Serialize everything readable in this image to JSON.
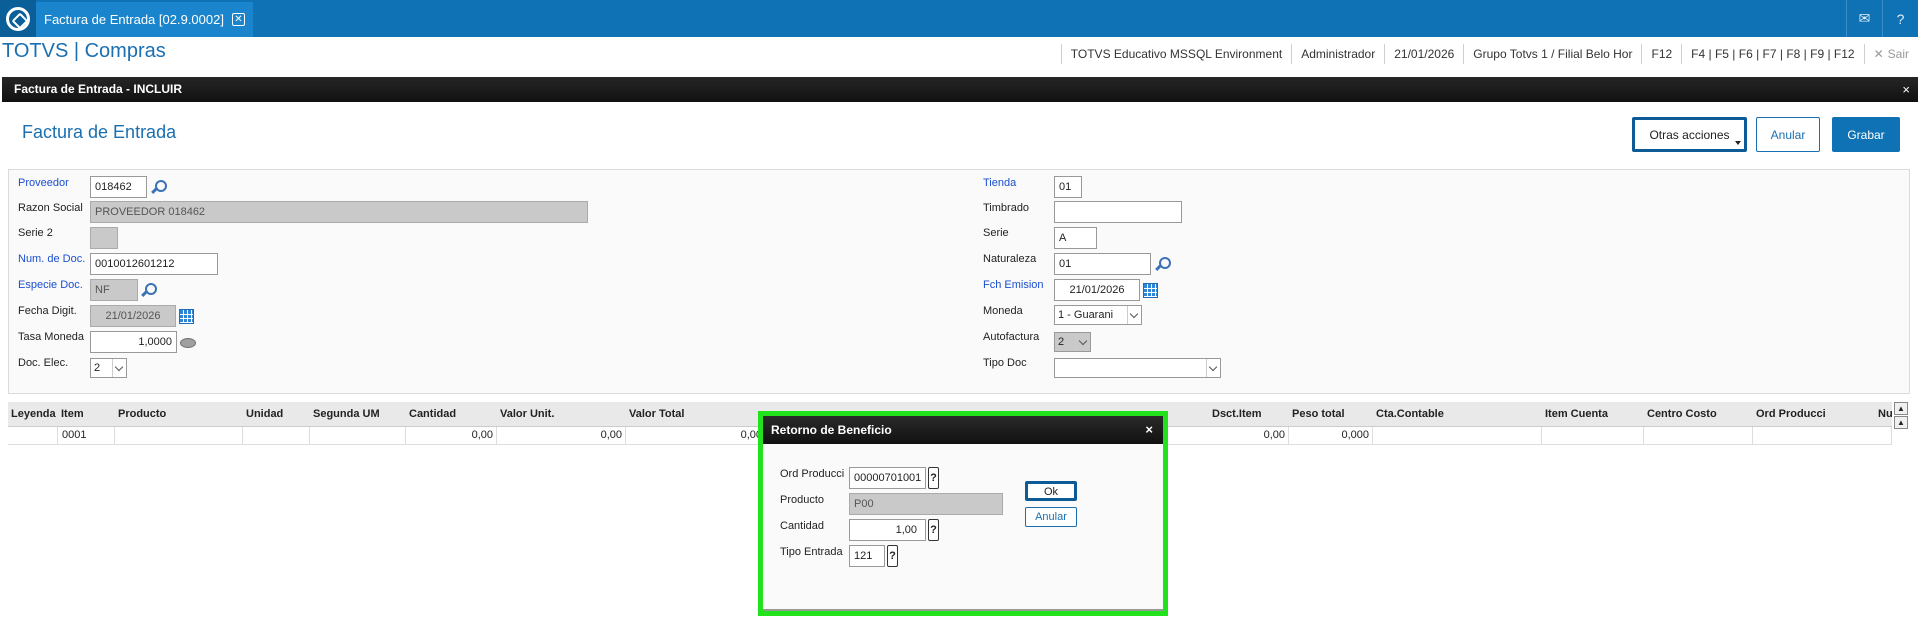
{
  "tab": {
    "title": "Factura de Entrada [02.9.0002]"
  },
  "app": {
    "title": "TOTVS | Compras"
  },
  "status": {
    "environment": "TOTVS Educativo MSSQL Environment",
    "user": "Administrador",
    "date": "21/01/2026",
    "branch": "Grupo Totvs 1 / Filial Belo Hor",
    "key_f12": "F12",
    "keys": "F4 | F5 | F6 | F7 | F8 | F9 | F12",
    "exit": "Sair"
  },
  "window": {
    "header": "Factura de Entrada - INCLUIR",
    "close": "×"
  },
  "form": {
    "title": "Factura de Entrada",
    "buttons": {
      "otras": "Otras acciones",
      "anular": "Anular",
      "grabar": "Grabar"
    },
    "left": {
      "proveedor_label": "Proveedor",
      "proveedor_value": "018462",
      "razon_label": "Razon Social",
      "razon_value": "PROVEEDOR 018462",
      "serie2_label": "Serie 2",
      "numdoc_label": "Num. de Doc.",
      "numdoc_value": "0010012601212",
      "especie_label": "Especie Doc.",
      "especie_value": "NF",
      "fecha_label": "Fecha Digit.",
      "fecha_value": "21/01/2026",
      "tasa_label": "Tasa Moneda",
      "tasa_value": "1,0000",
      "docelec_label": "Doc. Elec.",
      "docelec_value": "2"
    },
    "right": {
      "tienda_label": "Tienda",
      "tienda_value": "01",
      "timbrado_label": "Timbrado",
      "serie_label": "Serie",
      "serie_value": "A",
      "naturaleza_label": "Naturaleza",
      "naturaleza_value": "01",
      "fch_label": "Fch Emision",
      "fch_value": "21/01/2026",
      "moneda_label": "Moneda",
      "moneda_value": "1 - Guarani",
      "autofactura_label": "Autofactura",
      "autofactura_value": "2",
      "tipodoc_label": "Tipo Doc"
    }
  },
  "grid": {
    "headers": [
      "Leyenda",
      "Item",
      "Producto",
      "Unidad",
      "Segunda UM",
      "Cantidad",
      "Valor Unit.",
      "Valor Total",
      "Dsct.Item",
      "Peso total",
      "Cta.Contable",
      "Item Cuenta",
      "Centro Costo",
      "Ord Producci",
      "Nu"
    ],
    "row": {
      "item": "0001",
      "cantidad": "0,00",
      "valor_unit": "0,00",
      "valor_total": "0,00",
      "dsct": "0,00",
      "peso": "0,000"
    }
  },
  "modal": {
    "title": "Retorno de Beneficio",
    "close": "×",
    "ord_label": "Ord Producci",
    "ord_value": "00000701001",
    "prod_label": "Producto",
    "prod_value": "P00",
    "cant_label": "Cantidad",
    "cant_value": "1,00",
    "tipo_label": "Tipo Entrada",
    "tipo_value": "121",
    "help": "?",
    "ok": "Ok",
    "anular": "Anular"
  },
  "colors": {
    "brand": "#0e72b5",
    "highlight": "#22e31b",
    "link_label": "#1a4fd0"
  }
}
